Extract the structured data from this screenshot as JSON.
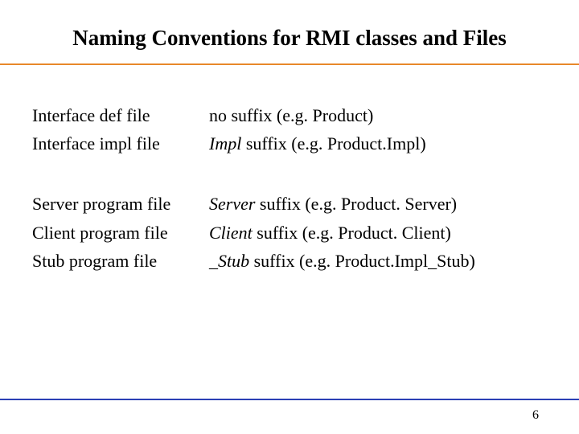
{
  "title": "Naming Conventions for RMI classes and Files",
  "group1": {
    "row1": {
      "left": "Interface def file",
      "right_plain": "no suffix (e.g. Product)"
    },
    "row2": {
      "left": "Interface impl file",
      "right_italic": "Impl",
      "right_rest": " suffix (e.g. Product.Impl)"
    }
  },
  "group2": {
    "row1": {
      "left": "Server program file",
      "right_italic": "Server",
      "right_rest": " suffix (e.g. Product. Server)"
    },
    "row2": {
      "left": "Client program file",
      "right_italic": "Client",
      "right_rest": " suffix (e.g. Product. Client)"
    },
    "row3": {
      "left": "Stub program file",
      "right_italic": " _Stub",
      "right_rest": " suffix (e.g. Product.Impl_Stub)"
    }
  },
  "page_number": "6"
}
